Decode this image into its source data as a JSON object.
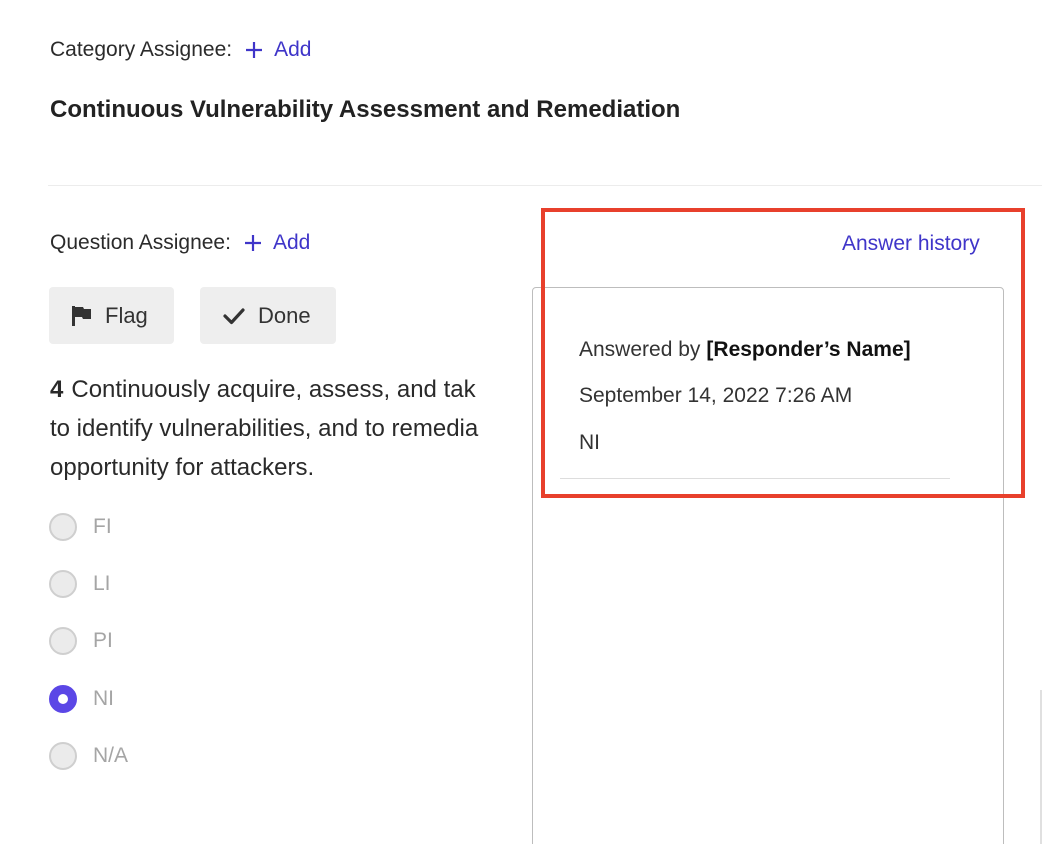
{
  "category": {
    "assignee_label": "Category Assignee:",
    "add_label": "Add",
    "title": "Continuous Vulnerability Assessment and Remediation"
  },
  "question": {
    "assignee_label": "Question Assignee:",
    "add_label": "Add",
    "flag_label": "Flag",
    "done_label": "Done",
    "number": "4",
    "lines": [
      "Continuously acquire, assess, and tak",
      "to identify vulnerabilities, and to remedia",
      "opportunity for attackers."
    ],
    "options": [
      {
        "label": "FI",
        "selected": false
      },
      {
        "label": "LI",
        "selected": false
      },
      {
        "label": "PI",
        "selected": false
      },
      {
        "label": "NI",
        "selected": true
      },
      {
        "label": "N/A",
        "selected": false
      }
    ]
  },
  "answer_history": {
    "link_label": "Answer history",
    "entries": [
      {
        "answered_by_label": "Answered by",
        "responder": "[Responder’s Name]",
        "date": "September 14, 2022 7:26 AM",
        "value": "NI"
      }
    ]
  },
  "colors": {
    "accent": "#3f35c9",
    "radio_selected": "#5b47e6",
    "highlight": "#e8402c"
  }
}
